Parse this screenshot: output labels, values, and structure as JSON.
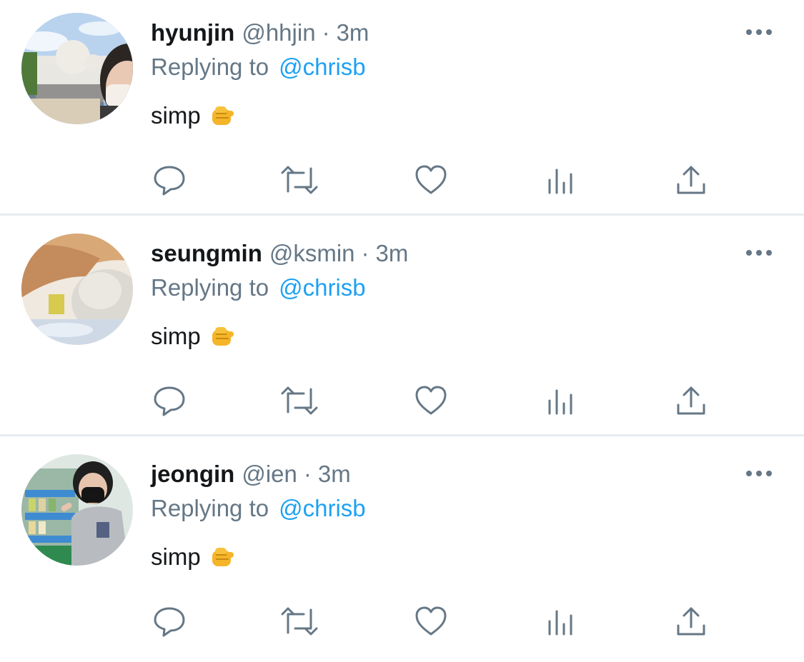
{
  "tweets": [
    {
      "name": "hyunjin",
      "handle": "@hhjin",
      "separator": "·",
      "time": "3m",
      "reply_prefix": "Replying to",
      "reply_to": "@chrisb",
      "text": "simp"
    },
    {
      "name": "seungmin",
      "handle": "@ksmin",
      "separator": "·",
      "time": "3m",
      "reply_prefix": "Replying to",
      "reply_to": "@chrisb",
      "text": "simp"
    },
    {
      "name": "jeongin",
      "handle": "@ien",
      "separator": "·",
      "time": "3m",
      "reply_prefix": "Replying to",
      "reply_to": "@chrisb",
      "text": "simp"
    }
  ],
  "icons": {
    "more": "more-horizontal-icon",
    "reply": "reply-bubble-icon",
    "retweet": "retweet-icon",
    "like": "heart-icon",
    "views": "analytics-bars-icon",
    "share": "share-upload-icon",
    "emoji": "pointing-fist-emoji"
  },
  "colors": {
    "text": "#14171a",
    "secondary": "#657786",
    "link": "#1da1f2",
    "divider": "#e6ecf0",
    "background": "#ffffff"
  }
}
